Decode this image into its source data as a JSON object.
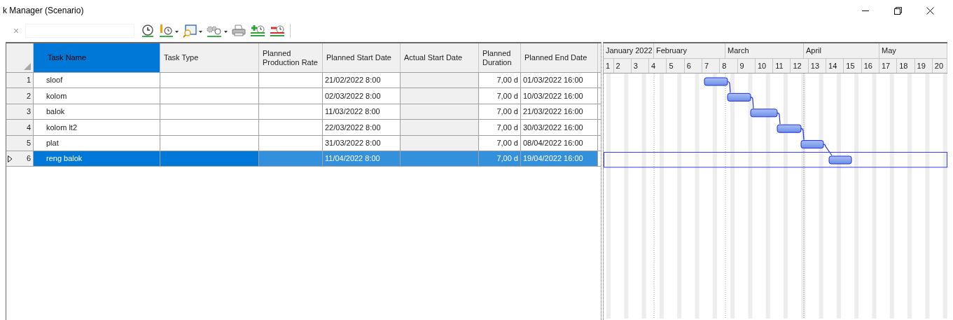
{
  "window": {
    "title": "k Manager (Scenario)"
  },
  "toolbar": {
    "clear_button": "×"
  },
  "table": {
    "columns": [
      {
        "label": "Task Name",
        "selected": true
      },
      {
        "label": "Task Type",
        "selected": false
      },
      {
        "label": "Planned Production Rate",
        "selected": false
      },
      {
        "label": "Planned Start Date",
        "selected": false
      },
      {
        "label": "Actual Start Date",
        "selected": false
      },
      {
        "label": "Planned Duration",
        "selected": false
      },
      {
        "label": "Planned End Date",
        "selected": false
      }
    ],
    "rows": [
      {
        "number": "1",
        "task_name": "sloof",
        "planned_start": "21/02/2022 8:00",
        "planned_duration": "7,00 d",
        "planned_end": "01/03/2022 16:00",
        "selected": false
      },
      {
        "number": "2",
        "task_name": "kolom",
        "planned_start": "02/03/2022 8:00",
        "planned_duration": "7,00 d",
        "planned_end": "10/03/2022 16:00",
        "selected": false
      },
      {
        "number": "3",
        "task_name": "balok",
        "planned_start": "11/03/2022 8:00",
        "planned_duration": "7,00 d",
        "planned_end": "21/03/2022 16:00",
        "selected": false
      },
      {
        "number": "4",
        "task_name": "kolom lt2",
        "planned_start": "22/03/2022 8:00",
        "planned_duration": "7,00 d",
        "planned_end": "30/03/2022 16:00",
        "selected": false
      },
      {
        "number": "5",
        "task_name": "plat",
        "planned_start": "31/03/2022 8:00",
        "planned_duration": "7,00 d",
        "planned_end": "08/04/2022 16:00",
        "selected": false
      },
      {
        "number": "6",
        "task_name": "reng balok",
        "planned_start": "11/04/2022 8:00",
        "planned_duration": "7,00 d",
        "planned_end": "19/04/2022 16:00",
        "selected": true
      }
    ]
  },
  "gantt": {
    "months": [
      "January 2022",
      "February",
      "March",
      "April",
      "May"
    ],
    "weeks": [
      "1",
      "2",
      "3",
      "4",
      "5",
      "6",
      "7",
      "8",
      "9",
      "10",
      "11",
      "12",
      "13",
      "14",
      "15",
      "16",
      "17",
      "18",
      "19",
      "20"
    ]
  }
}
